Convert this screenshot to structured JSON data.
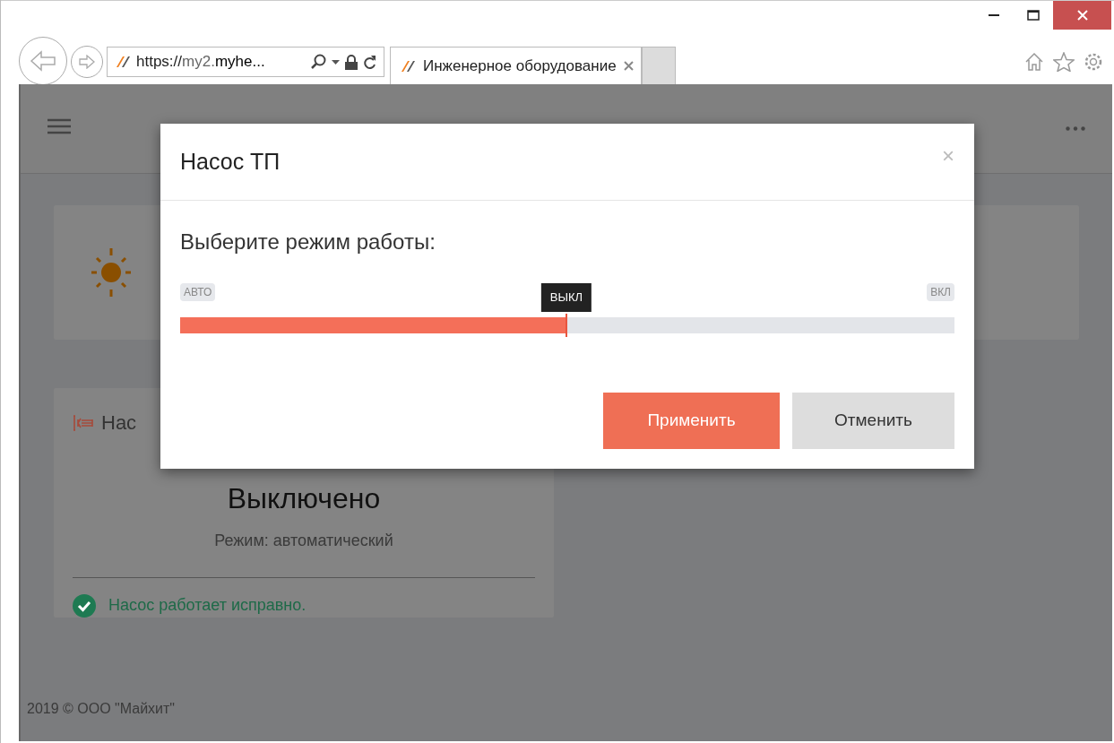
{
  "browser": {
    "address": {
      "prefix": "https://",
      "host_light": "my2.",
      "host_bold": "myhe..."
    },
    "tab": {
      "title": "Инженерное оборудование",
      "selected": true
    }
  },
  "page": {
    "weather_card": {
      "kind": "sun"
    },
    "pump_card": {
      "title": "Нас",
      "state": "Выключено",
      "mode": "Режим: автоматический",
      "status": "Насос работает исправно."
    },
    "footer": "2019 © ООО \"Майхит\""
  },
  "dialog": {
    "title": "Насос ТП",
    "close": "×",
    "prompt": "Выберите режим работы:",
    "slider": {
      "min_label": "АВТО",
      "max_label": "ВКЛ",
      "value_label": "ВЫКЛ",
      "level": 0.5
    },
    "buttons": [
      {
        "label": "Применить",
        "kind": "primary"
      },
      {
        "label": "Отменить",
        "kind": "secondary"
      }
    ]
  }
}
